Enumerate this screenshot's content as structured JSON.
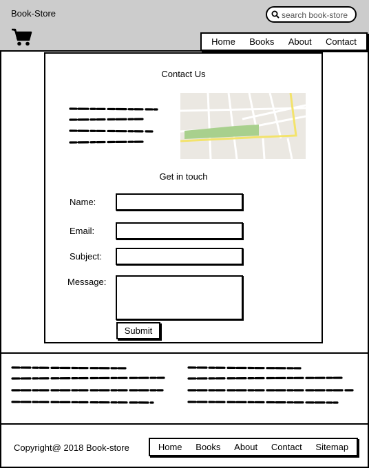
{
  "header": {
    "title": "Book-Store",
    "search_placeholder": "search book-store",
    "nav": [
      "Home",
      "Books",
      "About",
      "Contact"
    ]
  },
  "contact": {
    "title": "Contact Us",
    "subtitle": "Get in touch",
    "fields": {
      "name_label": "Name:",
      "email_label": "Email:",
      "subject_label": "Subject:",
      "message_label": "Message:"
    },
    "submit_label": "Submit"
  },
  "footer": {
    "copyright": "Copyright@ 2018 Book-store",
    "nav": [
      "Home",
      "Books",
      "About",
      "Contact",
      "Sitemap"
    ]
  },
  "colors": {
    "header_bg": "#cccccc",
    "map_bg": "#ebe8e2",
    "map_road": "#ffffff",
    "map_main_road": "#f3e36b",
    "map_park": "#a8d08d"
  }
}
